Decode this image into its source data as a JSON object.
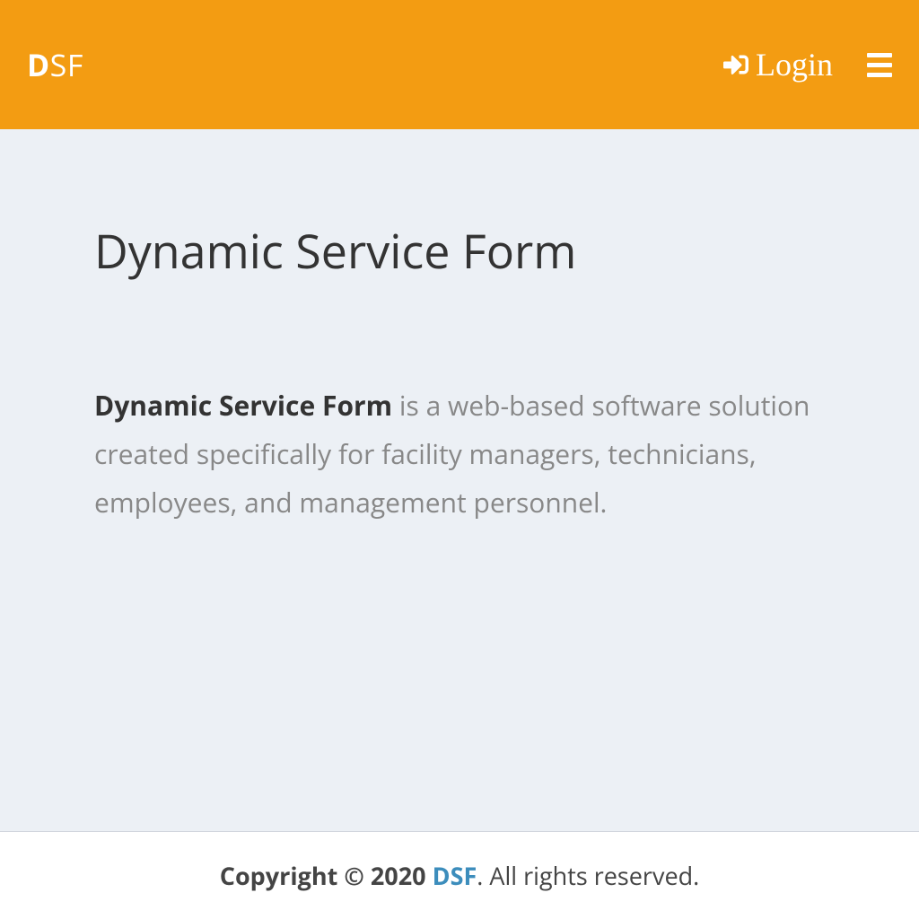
{
  "navbar": {
    "brand_first": "D",
    "brand_rest": "SF",
    "login_label": "Login"
  },
  "main": {
    "title": "Dynamic Service Form",
    "description_emphasis": "Dynamic Service Form",
    "description_rest": " is a web-based software solution created specifically for facility managers, technicians, employees, and management personnel."
  },
  "footer": {
    "copyright_prefix": "Copyright © 2020 ",
    "brand_link": "DSF",
    "copyright_suffix": ". All rights reserved."
  }
}
